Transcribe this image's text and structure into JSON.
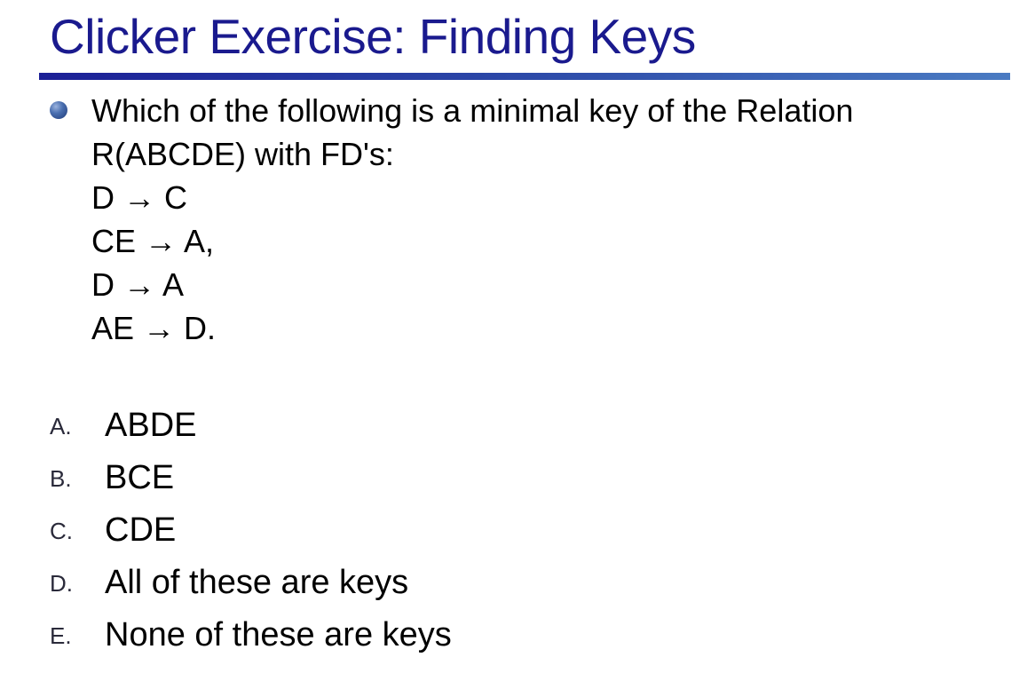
{
  "slide": {
    "title": "Clicker Exercise: Finding Keys",
    "accent_color": "#1a1a8e",
    "bullet_icon": "bullet-sphere-icon"
  },
  "question": {
    "lines": [
      "Which of the following is a minimal key of the Relation",
      "R(ABCDE) with FD's:"
    ],
    "fds": [
      "D → C",
      "CE → A,",
      "D → A",
      "AE → D."
    ]
  },
  "options": [
    {
      "letter": "A.",
      "text": "ABDE"
    },
    {
      "letter": "B.",
      "text": "BCE"
    },
    {
      "letter": "C.",
      "text": "CDE"
    },
    {
      "letter": "D.",
      "text": "All of these are keys"
    },
    {
      "letter": "E.",
      "text": "None of these are keys"
    }
  ]
}
